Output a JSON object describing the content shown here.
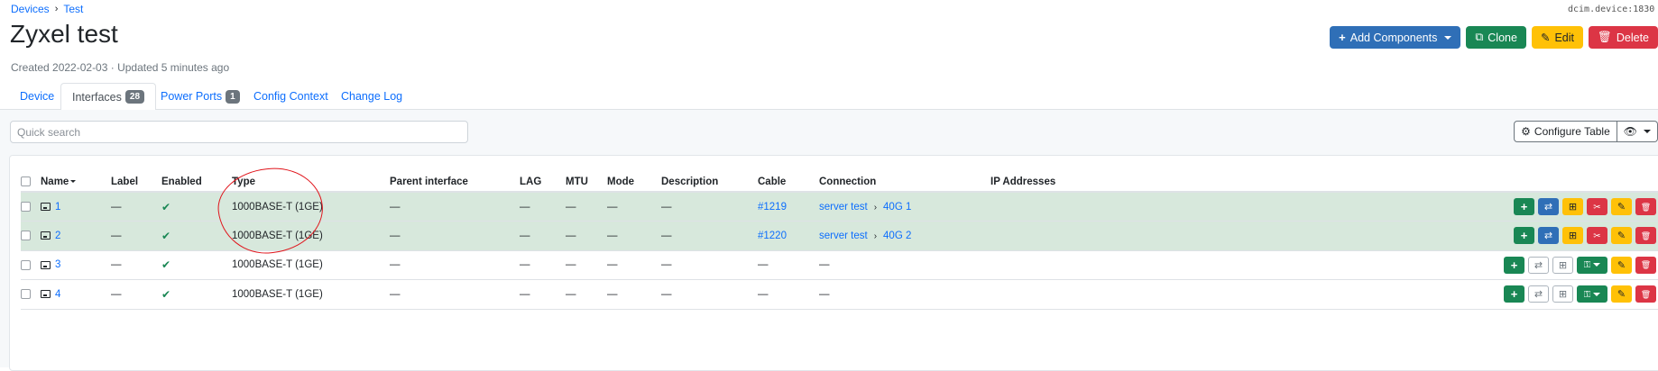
{
  "breadcrumb": {
    "devices": "Devices",
    "separator": "›",
    "test": "Test"
  },
  "object_id": "dcim.device:1830",
  "title": "Zyxel test",
  "meta": "Created 2022-02-03 · Updated 5 minutes ago",
  "actions": {
    "add_components": "Add Components",
    "clone": "Clone",
    "edit": "Edit",
    "delete": "Delete"
  },
  "tabs": [
    {
      "label": "Device"
    },
    {
      "label": "Interfaces",
      "badge": "28"
    },
    {
      "label": "Power Ports",
      "badge": "1"
    },
    {
      "label": "Config Context"
    },
    {
      "label": "Change Log"
    }
  ],
  "search": {
    "placeholder": "Quick search",
    "value": ""
  },
  "configure_table": "Configure Table",
  "columns": [
    "Name",
    "Label",
    "Enabled",
    "Type",
    "Parent interface",
    "LAG",
    "MTU",
    "Mode",
    "Description",
    "Cable",
    "Connection",
    "IP Addresses"
  ],
  "rows": [
    {
      "name": "1",
      "label": "—",
      "enabled": "✔",
      "type": "1000BASE-T (1GE)",
      "parent": "—",
      "lag": "—",
      "mtu": "—",
      "mode": "—",
      "description": "—",
      "cable": "#1219",
      "conn_device": "server test",
      "conn_sep": "›",
      "conn_iface": "40G 1",
      "ip": ""
    },
    {
      "name": "2",
      "label": "—",
      "enabled": "✔",
      "type": "1000BASE-T (1GE)",
      "parent": "—",
      "lag": "—",
      "mtu": "—",
      "mode": "—",
      "description": "—",
      "cable": "#1220",
      "conn_device": "server test",
      "conn_sep": "›",
      "conn_iface": "40G 2",
      "ip": ""
    },
    {
      "name": "3",
      "label": "—",
      "enabled": "✔",
      "type": "1000BASE-T (1GE)",
      "parent": "—",
      "lag": "—",
      "mtu": "—",
      "mode": "—",
      "description": "—",
      "cable": "—",
      "connection": "—",
      "ip": ""
    },
    {
      "name": "4",
      "label": "—",
      "enabled": "✔",
      "type": "1000BASE-T (1GE)",
      "parent": "—",
      "lag": "—",
      "mtu": "—",
      "mode": "—",
      "description": "—",
      "cable": "—",
      "connection": "—",
      "ip": ""
    }
  ],
  "colors": {
    "primary": "#2f6fb7",
    "success": "#198754",
    "warning": "#ffc107",
    "danger": "#dc3545",
    "connected_row": "#d7e8dc",
    "annotation": "#e0141b"
  }
}
